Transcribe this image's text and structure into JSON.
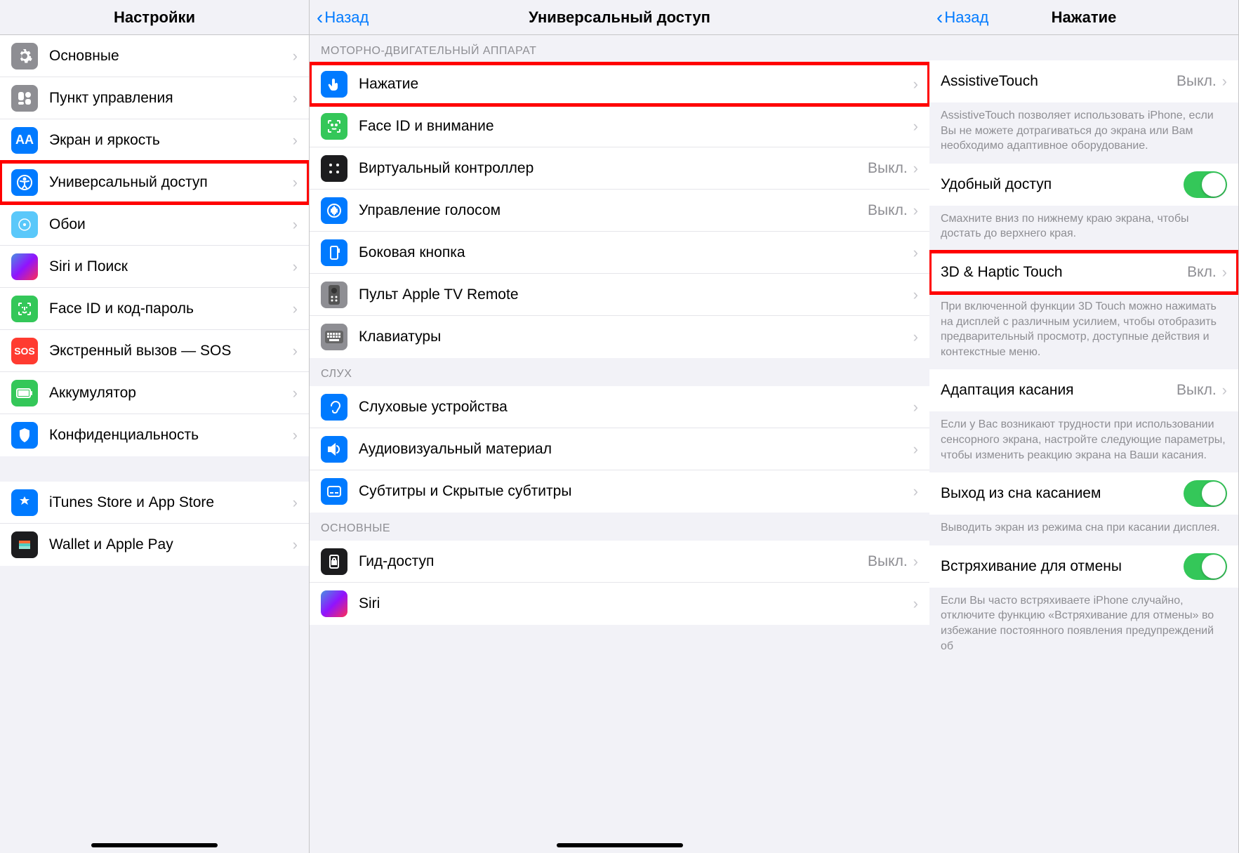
{
  "panel1": {
    "title": "Настройки",
    "items": [
      {
        "label": "Основные"
      },
      {
        "label": "Пункт управления"
      },
      {
        "label": "Экран и яркость"
      },
      {
        "label": "Универсальный доступ"
      },
      {
        "label": "Обои"
      },
      {
        "label": "Siri и Поиск"
      },
      {
        "label": "Face ID и код-пароль"
      },
      {
        "label": "Экстренный вызов — SOS"
      },
      {
        "label": "Аккумулятор"
      },
      {
        "label": "Конфиденциальность"
      }
    ],
    "items2": [
      {
        "label": "iTunes Store и App Store"
      },
      {
        "label": "Wallet и Apple Pay"
      }
    ]
  },
  "panel2": {
    "back": "Назад",
    "title": "Универсальный доступ",
    "section1_header": "МОТОРНО-ДВИГАТЕЛЬНЫЙ АППАРАТ",
    "items1": [
      {
        "label": "Нажатие",
        "value": ""
      },
      {
        "label": "Face ID и внимание",
        "value": ""
      },
      {
        "label": "Виртуальный контроллер",
        "value": "Выкл."
      },
      {
        "label": "Управление голосом",
        "value": "Выкл."
      },
      {
        "label": "Боковая кнопка",
        "value": ""
      },
      {
        "label": "Пульт Apple TV Remote",
        "value": ""
      },
      {
        "label": "Клавиатуры",
        "value": ""
      }
    ],
    "section2_header": "СЛУХ",
    "items2": [
      {
        "label": "Слуховые устройства",
        "value": ""
      },
      {
        "label": "Аудиовизуальный материал",
        "value": ""
      },
      {
        "label": "Субтитры и Скрытые субтитры",
        "value": ""
      }
    ],
    "section3_header": "ОСНОВНЫЕ",
    "items3": [
      {
        "label": "Гид-доступ",
        "value": "Выкл."
      },
      {
        "label": "Siri",
        "value": ""
      }
    ]
  },
  "panel3": {
    "back": "Назад",
    "title": "Нажатие",
    "rows": {
      "assistive": {
        "label": "AssistiveTouch",
        "value": "Выкл."
      },
      "assistive_footer": "AssistiveTouch позволяет использовать iPhone, если Вы не можете дотрагиваться до экрана или Вам необходимо адаптивное оборудование.",
      "reach": {
        "label": "Удобный доступ"
      },
      "reach_footer": "Смахните вниз по нижнему краю экрана, чтобы достать до верхнего края.",
      "haptic": {
        "label": "3D & Haptic Touch",
        "value": "Вкл."
      },
      "haptic_footer": "При включенной функции 3D Touch можно нажимать на дисплей с различным усилием, чтобы отобразить предварительный просмотр, доступные действия и контекстные меню.",
      "accom": {
        "label": "Адаптация касания",
        "value": "Выкл."
      },
      "accom_footer": "Если у Вас возникают трудности при использовании сенсорного экрана, настройте следующие параметры, чтобы изменить реакцию экрана на Ваши касания.",
      "wake": {
        "label": "Выход из сна касанием"
      },
      "wake_footer": "Выводить экран из режима сна при касании дисплея.",
      "shake": {
        "label": "Встряхивание для отмены"
      },
      "shake_footer": "Если Вы часто встряхиваете iPhone случайно, отключите функцию «Встряхивание для отмены» во избежание постоянного появления предупреждений об"
    }
  }
}
